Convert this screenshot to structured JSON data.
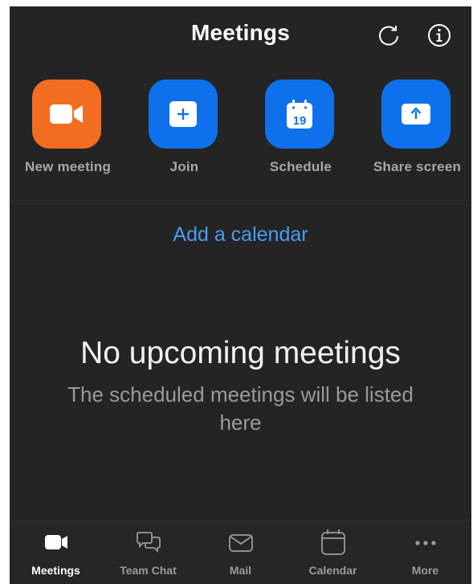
{
  "header": {
    "title": "Meetings",
    "refresh_icon": "refresh-icon",
    "info_icon": "info-icon"
  },
  "actions": [
    {
      "label": "New meeting",
      "icon": "video-camera-icon",
      "color": "#f26d21"
    },
    {
      "label": "Join",
      "icon": "plus-icon",
      "color": "#0e71eb"
    },
    {
      "label": "Schedule",
      "icon": "calendar-icon",
      "calendar_day": "19",
      "color": "#0e71eb"
    },
    {
      "label": "Share screen",
      "icon": "share-arrow-icon",
      "color": "#0e71eb"
    }
  ],
  "add_calendar": "Add a calendar",
  "empty_state": {
    "title": "No upcoming meetings",
    "subtitle": "The scheduled meetings will be listed here"
  },
  "tabs": [
    {
      "label": "Meetings",
      "icon": "video-camera-icon",
      "active": true
    },
    {
      "label": "Team Chat",
      "icon": "chat-bubbles-icon",
      "active": false
    },
    {
      "label": "Mail",
      "icon": "envelope-icon",
      "active": false
    },
    {
      "label": "Calendar",
      "icon": "calendar-icon",
      "active": false
    },
    {
      "label": "More",
      "icon": "more-dots-icon",
      "active": false
    }
  ],
  "colors": {
    "background": "#242424",
    "accent_blue": "#0e71eb",
    "link_blue": "#4a9bf5",
    "orange": "#f26d21"
  }
}
